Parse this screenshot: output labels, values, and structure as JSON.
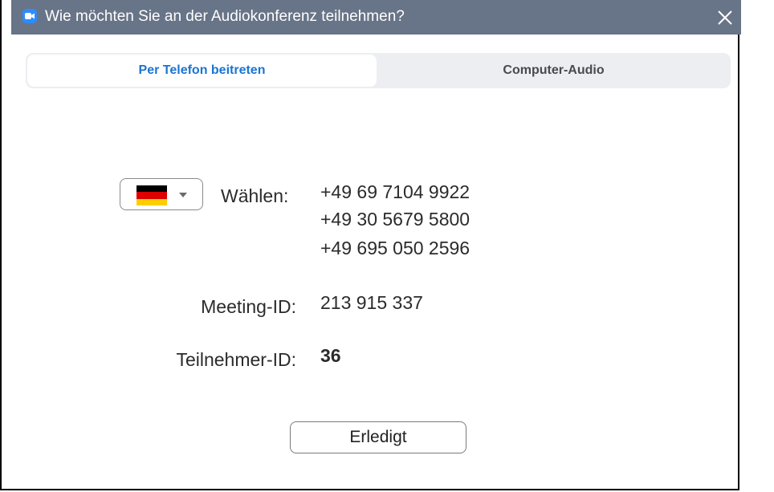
{
  "window": {
    "title": "Wie möchten Sie an der Audiokonferenz teilnehmen?",
    "app_icon": "zoom-camera-icon",
    "close_icon": "close-icon",
    "titlebar_color": "#687487",
    "accent_color": "#2d8cff"
  },
  "tabs": [
    {
      "label": "Per Telefon beitreten",
      "active": true
    },
    {
      "label": "Computer-Audio",
      "active": false
    }
  ],
  "dial": {
    "country_flag": "germany-flag-icon",
    "label": "Wählen:",
    "numbers": [
      "+49 69 7104 9922",
      "+49 30 5679 5800",
      "+49 695 050 2596"
    ]
  },
  "meeting": {
    "label": "Meeting-ID:",
    "value": "213 915 337"
  },
  "participant": {
    "label": "Teilnehmer-ID:",
    "value": "36"
  },
  "done_button": {
    "label": "Erledigt"
  }
}
